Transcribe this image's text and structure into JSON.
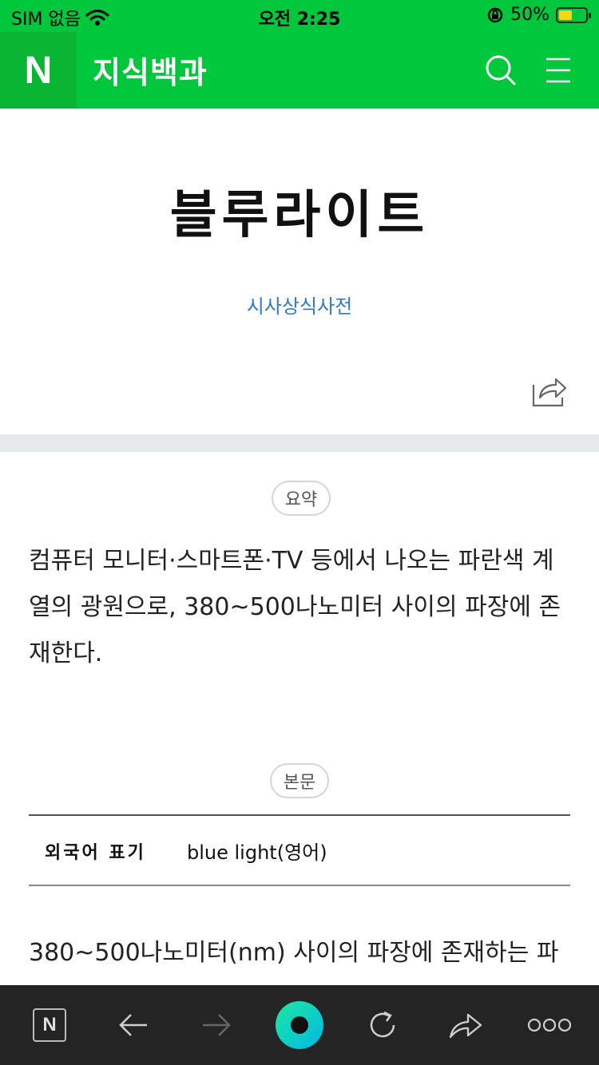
{
  "status_bar": {
    "carrier": "SIM 없음",
    "time": "오전 2:25",
    "battery": "50%",
    "battery_level": 0.5
  },
  "header": {
    "logo": "N",
    "title": "지식백과"
  },
  "article": {
    "title": "블루라이트",
    "source": "시사상식사전"
  },
  "summary": {
    "badge": "요약",
    "text": "컴퓨터 모니터·스마트폰·TV 등에서 나오는 파란색 계열의 광원으로, 380~500나노미터 사이의 파장에 존재한다."
  },
  "main": {
    "badge": "본문",
    "info_label": "외국어 표기",
    "info_value": "blue light(영어)",
    "body_text": "380~500나노미터(nm) 사이의 파장에 존재하는 파"
  },
  "toolbar": {
    "home_logo": "N"
  },
  "colors": {
    "brand_green": "#00c73c",
    "logo_green": "#0bb534",
    "link_blue": "#2e7ad1",
    "toolbar_bg": "#242424"
  }
}
